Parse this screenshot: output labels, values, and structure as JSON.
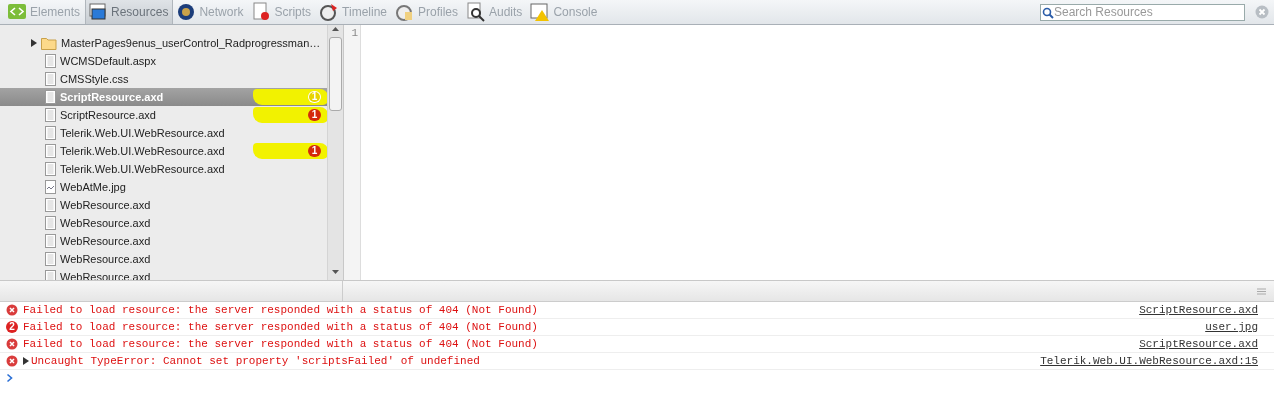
{
  "toolbar": {
    "tabs": [
      {
        "label": "Elements",
        "selected": false,
        "kind": "elements"
      },
      {
        "label": "Resources",
        "selected": true,
        "kind": "resources"
      },
      {
        "label": "Network",
        "selected": false,
        "kind": "network"
      },
      {
        "label": "Scripts",
        "selected": false,
        "kind": "scripts"
      },
      {
        "label": "Timeline",
        "selected": false,
        "kind": "timeline"
      },
      {
        "label": "Profiles",
        "selected": false,
        "kind": "profiles"
      },
      {
        "label": "Audits",
        "selected": false,
        "kind": "audits"
      },
      {
        "label": "Console",
        "selected": false,
        "kind": "console"
      }
    ],
    "search": {
      "placeholder": "Search Resources"
    }
  },
  "sidebar": {
    "items": [
      {
        "name": "MasterPages9enus_userControl_Radprogressman…",
        "kind": "folder",
        "expanded": false,
        "selected": false,
        "highlighted": false
      },
      {
        "name": "WCMSDefault.aspx",
        "kind": "document",
        "selected": false,
        "highlighted": false
      },
      {
        "name": "CMSStyle.css",
        "kind": "document",
        "selected": false,
        "highlighted": false
      },
      {
        "name": "ScriptResource.axd",
        "kind": "document",
        "selected": true,
        "highlighted": true,
        "badge": "1",
        "color": "#e8d400"
      },
      {
        "name": "ScriptResource.axd",
        "kind": "document",
        "selected": false,
        "highlighted": true,
        "badge": "1",
        "color": "#d42a0c"
      },
      {
        "name": "Telerik.Web.UI.WebResource.axd",
        "kind": "document",
        "selected": false,
        "highlighted": false
      },
      {
        "name": "Telerik.Web.UI.WebResource.axd",
        "kind": "document",
        "selected": false,
        "highlighted": true,
        "badge": "1",
        "color": "#d42a0c"
      },
      {
        "name": "Telerik.Web.UI.WebResource.axd",
        "kind": "document",
        "selected": false,
        "highlighted": false
      },
      {
        "name": "WebAtMe.jpg",
        "kind": "image",
        "selected": false,
        "highlighted": false
      },
      {
        "name": "WebResource.axd",
        "kind": "document",
        "selected": false,
        "highlighted": false
      },
      {
        "name": "WebResource.axd",
        "kind": "document",
        "selected": false,
        "highlighted": false
      },
      {
        "name": "WebResource.axd",
        "kind": "document",
        "selected": false,
        "highlighted": false
      },
      {
        "name": "WebResource.axd",
        "kind": "document",
        "selected": false,
        "highlighted": false
      },
      {
        "name": "WebResource.axd",
        "kind": "document",
        "selected": false,
        "highlighted": false
      }
    ]
  },
  "editor": {
    "line_numbers": [
      "1"
    ]
  },
  "console": {
    "messages": [
      {
        "text": "Failed to load resource: the server responded with a status of 404 (Not Found)",
        "source": "ScriptResource.axd",
        "kind": "error"
      },
      {
        "text": "Failed to load resource: the server responded with a status of 404 (Not Found)",
        "source": "user.jpg",
        "kind": "repeated",
        "count": "2"
      },
      {
        "text": "Failed to load resource: the server responded with a status of 404 (Not Found)",
        "source": "ScriptResource.axd",
        "kind": "error"
      },
      {
        "text": "Uncaught TypeError: Cannot set property 'scriptsFailed' of undefined",
        "source": "Telerik.Web.UI.WebResource.axd:15",
        "kind": "exception",
        "expanded": false
      }
    ]
  }
}
